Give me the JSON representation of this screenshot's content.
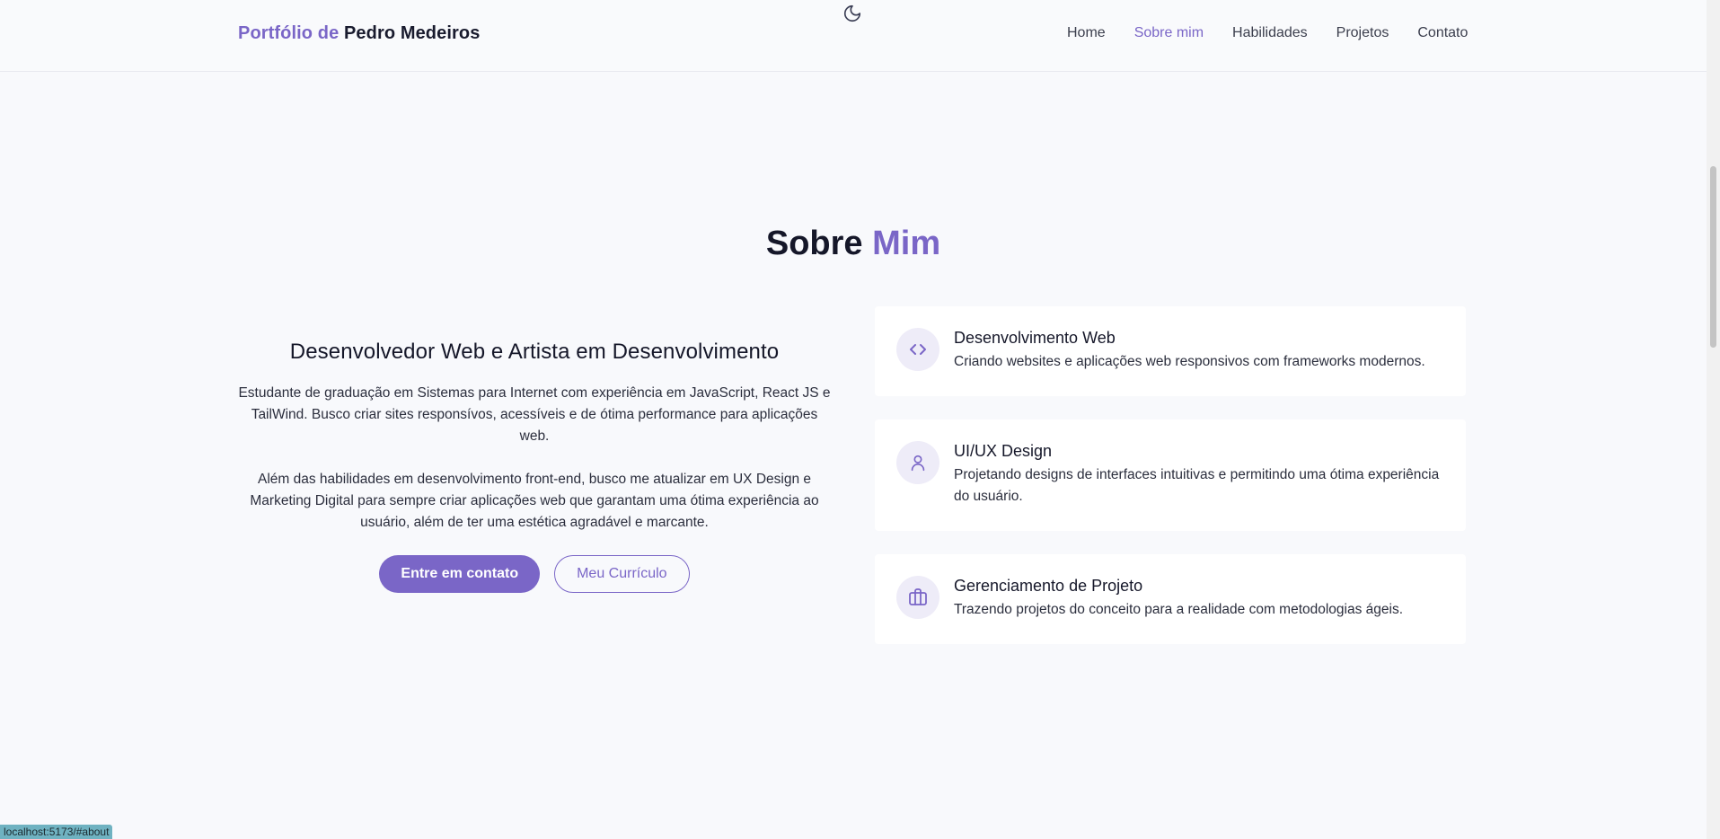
{
  "header": {
    "brand_prefix": "Portfólio de",
    "brand_name": "Pedro Medeiros",
    "theme_toggle_icon": "moon-icon",
    "nav": [
      {
        "label": "Home"
      },
      {
        "label": "Sobre mim",
        "active": true
      },
      {
        "label": "Habilidades"
      },
      {
        "label": "Projetos"
      },
      {
        "label": "Contato"
      }
    ]
  },
  "about": {
    "title_main": "Sobre",
    "title_accent": "Mim",
    "subtitle": "Desenvolvedor Web e Artista em Desenvolvimento",
    "paragraph1": "Estudante de graduação em Sistemas para Internet com experiência em JavaScript, React JS e TailWind. Busco criar sites responsívos, acessíveis e de ótima performance para aplicações web.",
    "paragraph2": "Além das habilidades em desenvolvimento front-end, busco me atualizar em UX Design e Marketing Digital para sempre criar aplicações web que garantam uma ótima experiência ao usuário, além de ter uma estética agradável e marcante.",
    "primary_button": "Entre em contato",
    "secondary_button": "Meu Currículo",
    "cards": [
      {
        "icon": "code-icon",
        "title": "Desenvolvimento Web",
        "description": "Criando websites e aplicações web responsivos com frameworks modernos."
      },
      {
        "icon": "user-icon",
        "title": "UI/UX Design",
        "description": "Projetando designs de interfaces intuitivas e permitindo uma ótima experiência do usuário."
      },
      {
        "icon": "briefcase-icon",
        "title": "Gerenciamento de Projeto",
        "description": "Trazendo projetos do conceito para a realidade com metodologias ágeis."
      }
    ]
  },
  "status_bar": {
    "url": "localhost:5173/#about"
  },
  "colors": {
    "accent": "#7a66c7",
    "background": "#f8f9fc",
    "heading": "#151729"
  }
}
